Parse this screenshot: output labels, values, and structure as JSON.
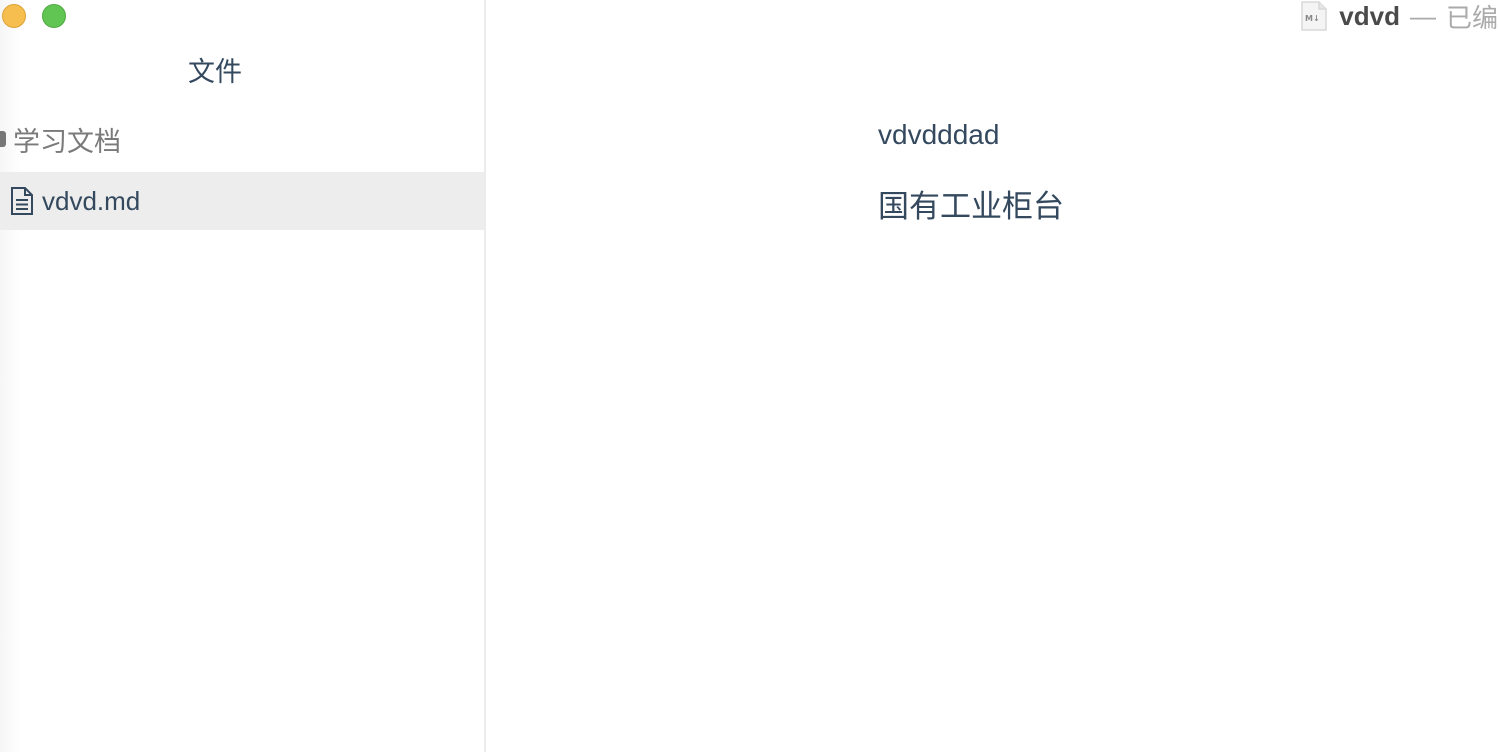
{
  "window": {
    "controls": {
      "minimize_color": "#f5be4f",
      "maximize_color": "#61c554"
    }
  },
  "sidebar": {
    "title": "文件",
    "folder": {
      "label": "学习文档",
      "icon": "folder-collapsed-icon"
    },
    "files": [
      {
        "label": "vdvd.md",
        "icon": "document-icon",
        "selected": true
      }
    ],
    "selected_bg": "#ededed"
  },
  "titlebar": {
    "file_icon": "markdown-file-icon",
    "doc_title": "vdvd",
    "separator": "—",
    "status": "已编"
  },
  "editor": {
    "paragraphs": [
      "vdvdddad",
      "国有工业柜台"
    ],
    "text_color": "#34495e"
  }
}
